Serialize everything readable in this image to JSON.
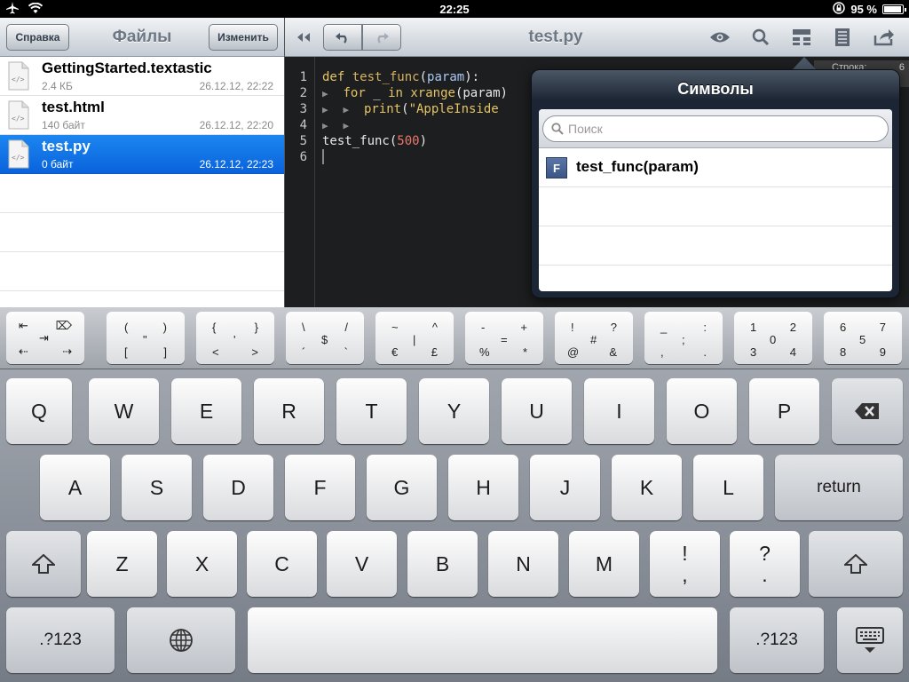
{
  "status": {
    "time": "22:25",
    "battery": "95 %",
    "battery_level": 0.95
  },
  "left_toolbar": {
    "help_label": "Справка",
    "title": "Файлы",
    "edit_label": "Изменить"
  },
  "files": [
    {
      "name": "GettingStarted.textastic",
      "size": "2.4 КБ",
      "date": "26.12.12, 22:22",
      "selected": false
    },
    {
      "name": "test.html",
      "size": "140 байт",
      "date": "26.12.12, 22:20",
      "selected": false
    },
    {
      "name": "test.py",
      "size": "0 байт",
      "date": "26.12.12, 22:23",
      "selected": true
    }
  ],
  "editor_toolbar": {
    "title": "test.py"
  },
  "editor": {
    "line_numbers": [
      "1",
      "2",
      "3",
      "4",
      "5",
      "6"
    ],
    "line_info": "Строка:",
    "line_info_value": "6",
    "lines": {
      "l1_def": "def",
      "l1_name": "test_func",
      "l1_open": "(",
      "l1_param": "param",
      "l1_close": "):",
      "l2_for": "for",
      "l2_mid": " _ ",
      "l2_in": "in",
      "l2_xrange": "xrange",
      "l2_rest": "(param)",
      "l3_print": "print",
      "l3_open": "(",
      "l3_str": "\"AppleInside",
      "l5_call": "test_func(",
      "l5_num": "500",
      "l5_close": ")"
    }
  },
  "symbols_popover": {
    "title": "Символы",
    "search_placeholder": "Поиск",
    "items": [
      {
        "badge": "F",
        "name": "test_func(param)"
      }
    ]
  },
  "keyboard": {
    "extra_row": [
      {
        "chars": [
          "⇤",
          "⌦",
          "⇥",
          "⇠",
          "⇢"
        ]
      },
      {
        "chars": [
          "(",
          ")",
          "\"",
          "[",
          "]"
        ]
      },
      {
        "chars": [
          "{",
          "}",
          "'",
          "<",
          ">"
        ]
      },
      {
        "chars": [
          "\\",
          "/",
          "$",
          "´",
          "`"
        ]
      },
      {
        "chars": [
          "~",
          "^",
          "|",
          "€",
          "£"
        ]
      },
      {
        "chars": [
          "-",
          "+",
          "=",
          "%",
          "*"
        ]
      },
      {
        "chars": [
          "!",
          "?",
          "#",
          "@",
          "&"
        ]
      },
      {
        "chars": [
          "_",
          ":",
          ";",
          ",",
          "."
        ]
      },
      {
        "chars": [
          "1",
          "2",
          "0",
          "3",
          "4"
        ]
      },
      {
        "chars": [
          "6",
          "7",
          "5",
          "8",
          "9"
        ]
      }
    ],
    "row1": [
      "Q",
      "W",
      "E",
      "R",
      "T",
      "Y",
      "U",
      "I",
      "O",
      "P"
    ],
    "row2": [
      "A",
      "S",
      "D",
      "F",
      "G",
      "H",
      "J",
      "K",
      "L"
    ],
    "row3": [
      "Z",
      "X",
      "C",
      "V",
      "B",
      "N",
      "M"
    ],
    "punct1": [
      "!",
      ","
    ],
    "punct2": [
      "?",
      "."
    ],
    "return_label": "return",
    "numbers_label": ".?123"
  }
}
